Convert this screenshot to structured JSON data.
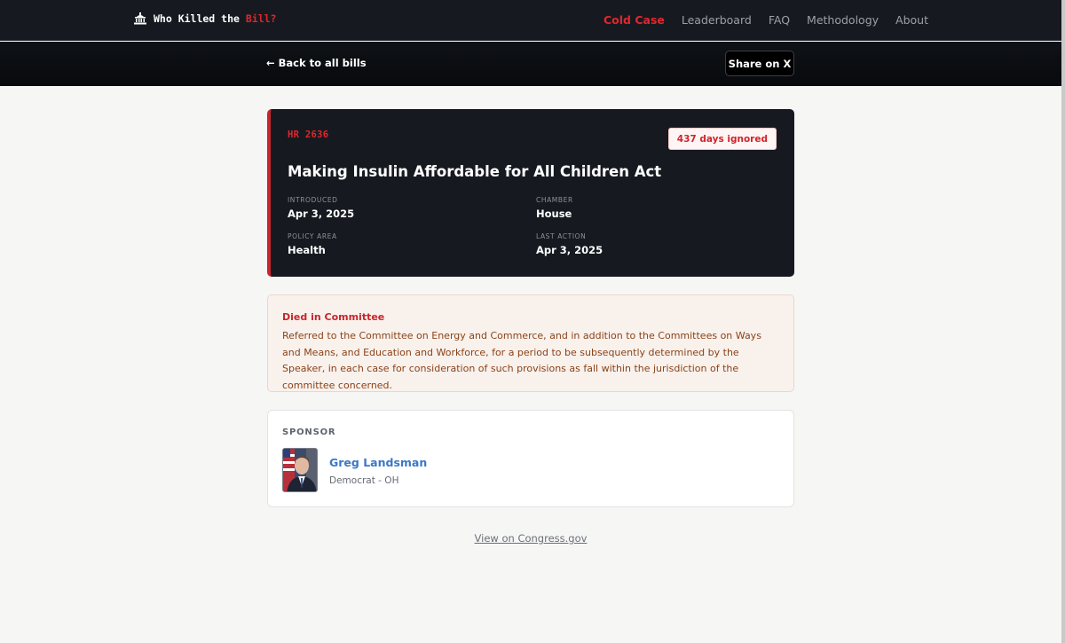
{
  "nav": {
    "brand_prefix": "Who Killed the ",
    "brand_accent": "Bill?",
    "brand_icon": "capitol-icon",
    "links": [
      {
        "label": "Cold Case",
        "active": true
      },
      {
        "label": "Leaderboard",
        "active": false
      },
      {
        "label": "FAQ",
        "active": false
      },
      {
        "label": "Methodology",
        "active": false
      },
      {
        "label": "About",
        "active": false
      }
    ]
  },
  "subbar": {
    "back_label": "← Back to all bills",
    "share_label": "Share on X"
  },
  "bill": {
    "id": "HR 2636",
    "days_ignored": "437 days ignored",
    "title": "Making Insulin Affordable for All Children Act",
    "meta": [
      {
        "label": "Introduced",
        "value": "Apr 3, 2025"
      },
      {
        "label": "Chamber",
        "value": "House"
      },
      {
        "label": "Policy Area",
        "value": "Health"
      },
      {
        "label": "Last Action",
        "value": "Apr 3, 2025"
      }
    ]
  },
  "status": {
    "title": "Died in Committee",
    "description": "Referred to the Committee on Energy and Commerce, and in addition to the Committees on Ways and Means, and Education and Workforce, for a period to be subsequently determined by the Speaker, in each case for consideration of such provisions as fall within the jurisdiction of the committee concerned."
  },
  "sponsor": {
    "label": "SPONSOR",
    "name": "Greg Landsman",
    "party": "Democrat - OH"
  },
  "footer": {
    "congress_link": "View on Congress.gov"
  },
  "colors": {
    "accent_red": "#e0262d",
    "dark_bg": "#161a20",
    "link_blue": "#3a78c8"
  }
}
